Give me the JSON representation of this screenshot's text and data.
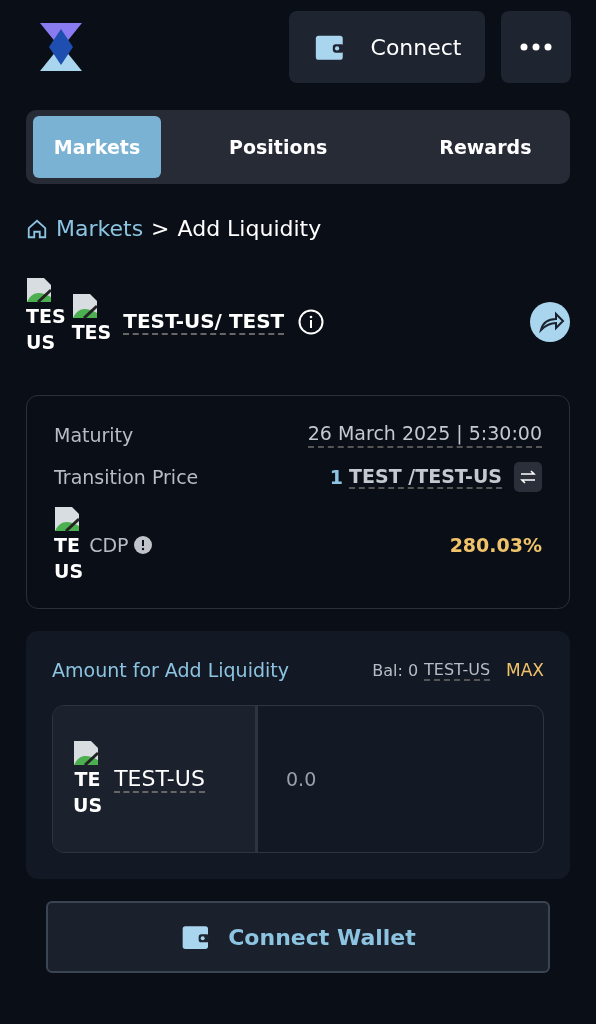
{
  "header": {
    "connect_label": "Connect"
  },
  "tabs": [
    {
      "label": "Markets",
      "selected": true
    },
    {
      "label": "Positions",
      "selected": false
    },
    {
      "label": "Rewards",
      "selected": false
    }
  ],
  "breadcrumb": {
    "home": "Markets",
    "separator": ">",
    "current": "Add Liquidity"
  },
  "pair": {
    "token_alts": [
      [
        "TES",
        "US"
      ],
      [
        "TES"
      ]
    ],
    "title": "TEST-US/ TEST"
  },
  "details": [
    {
      "kind": "text",
      "label": "Maturity",
      "value": "26 March 2025 | 5:30:00"
    },
    {
      "kind": "price",
      "label": "Transition Price",
      "amount": "1",
      "value": "TEST /TEST-US"
    },
    {
      "kind": "cdp",
      "alt": [
        "TE",
        "US"
      ],
      "label": "CDP",
      "value": "280.03%"
    }
  ],
  "amount": {
    "label": "Amount for Add Liquidity",
    "balance_prefix": "Bal: 0",
    "balance_token": "TEST-US",
    "max": "MAX",
    "token_alt": [
      "TE",
      "US"
    ],
    "token": "TEST-US",
    "placeholder": "0.0"
  },
  "connect_wallet": "Connect Wallet"
}
